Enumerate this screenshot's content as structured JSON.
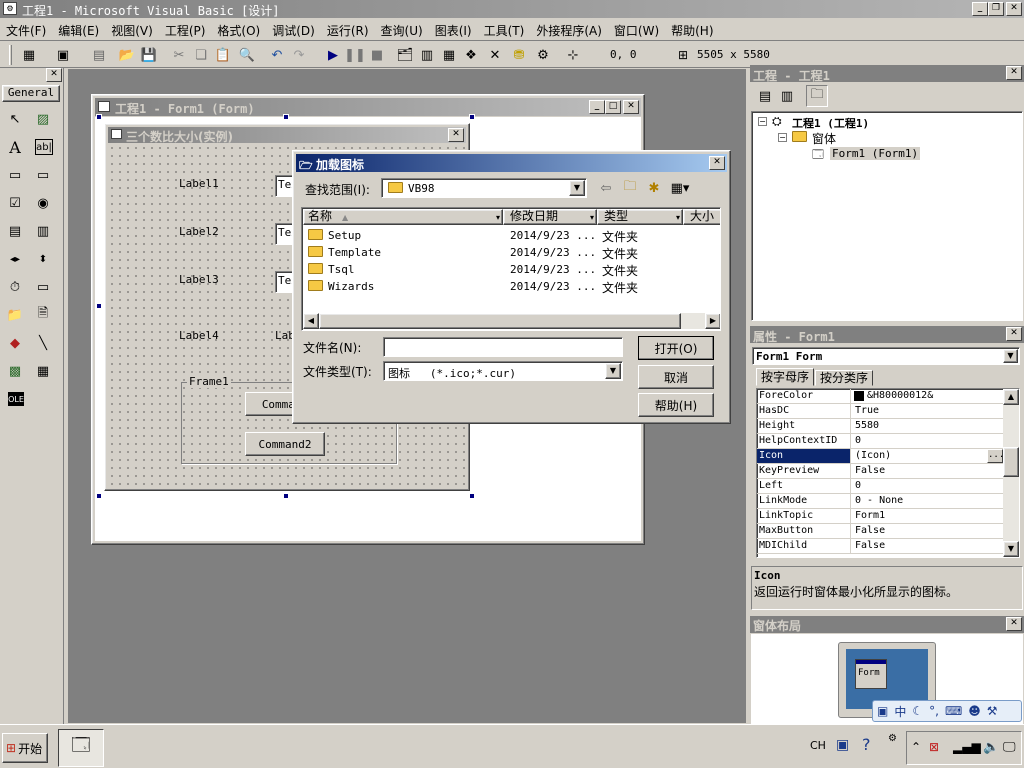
{
  "app": {
    "title": "工程1 - Microsoft Visual Basic [设计]"
  },
  "menu": [
    {
      "label": "文件(F)"
    },
    {
      "label": "编辑(E)"
    },
    {
      "label": "视图(V)"
    },
    {
      "label": "工程(P)"
    },
    {
      "label": "格式(O)"
    },
    {
      "label": "调试(D)"
    },
    {
      "label": "运行(R)"
    },
    {
      "label": "查询(U)"
    },
    {
      "label": "图表(I)"
    },
    {
      "label": "工具(T)"
    },
    {
      "label": "外接程序(A)"
    },
    {
      "label": "窗口(W)"
    },
    {
      "label": "帮助(H)"
    }
  ],
  "toolbar": {
    "position": "0, 0",
    "size": "5505 x 5580"
  },
  "toolbox": {
    "tab": "General"
  },
  "form_designer": {
    "title": "工程1 - Form1 (Form)",
    "form_title": "三个数比大小(实例)",
    "labels": [
      "Label1",
      "Label2",
      "Label3",
      "Label4",
      "Label5"
    ],
    "textbox": "Text",
    "frame": "Frame1",
    "command1": "Command",
    "command2": "Command2"
  },
  "dialog": {
    "title": "加载图标",
    "lookin_label": "查找范围(I):",
    "lookin_value": "VB98",
    "columns": [
      "名称",
      "修改日期",
      "类型",
      "大小"
    ],
    "files": [
      {
        "name": "Setup",
        "date": "2014/9/23 ...",
        "type": "文件夹"
      },
      {
        "name": "Template",
        "date": "2014/9/23 ...",
        "type": "文件夹"
      },
      {
        "name": "Tsql",
        "date": "2014/9/23 ...",
        "type": "文件夹"
      },
      {
        "name": "Wizards",
        "date": "2014/9/23 ...",
        "type": "文件夹"
      }
    ],
    "filename_label": "文件名(N):",
    "filename_value": "",
    "filetype_label": "文件类型(T):",
    "filetype_value": "图标   (*.ico;*.cur)",
    "open": "打开(O)",
    "cancel": "取消",
    "help": "帮助(H)"
  },
  "project": {
    "title": "工程 - 工程1",
    "root": "工程1 (工程1)",
    "folder": "窗体",
    "item": "Form1 (Form1)"
  },
  "properties": {
    "title": "属性 - Form1",
    "object": "Form1 Form",
    "tab_alpha": "按字母序",
    "tab_cat": "按分类序",
    "rows": [
      {
        "name": "ForeColor",
        "value": "&H80000012&"
      },
      {
        "name": "HasDC",
        "value": "True"
      },
      {
        "name": "Height",
        "value": "5580"
      },
      {
        "name": "HelpContextID",
        "value": "0"
      },
      {
        "name": "Icon",
        "value": "(Icon)"
      },
      {
        "name": "KeyPreview",
        "value": "False"
      },
      {
        "name": "Left",
        "value": "0"
      },
      {
        "name": "LinkMode",
        "value": "0 - None"
      },
      {
        "name": "LinkTopic",
        "value": "Form1"
      },
      {
        "name": "MaxButton",
        "value": "False"
      },
      {
        "name": "MDIChild",
        "value": "False"
      }
    ],
    "desc_title": "Icon",
    "desc_text": "返回运行时窗体最小化所显示的图标。"
  },
  "layout_window": {
    "title": "窗体布局",
    "form_label": "Form"
  },
  "ime": {
    "label": "中"
  },
  "taskbar": {
    "start": "开始",
    "lang": "CH"
  }
}
